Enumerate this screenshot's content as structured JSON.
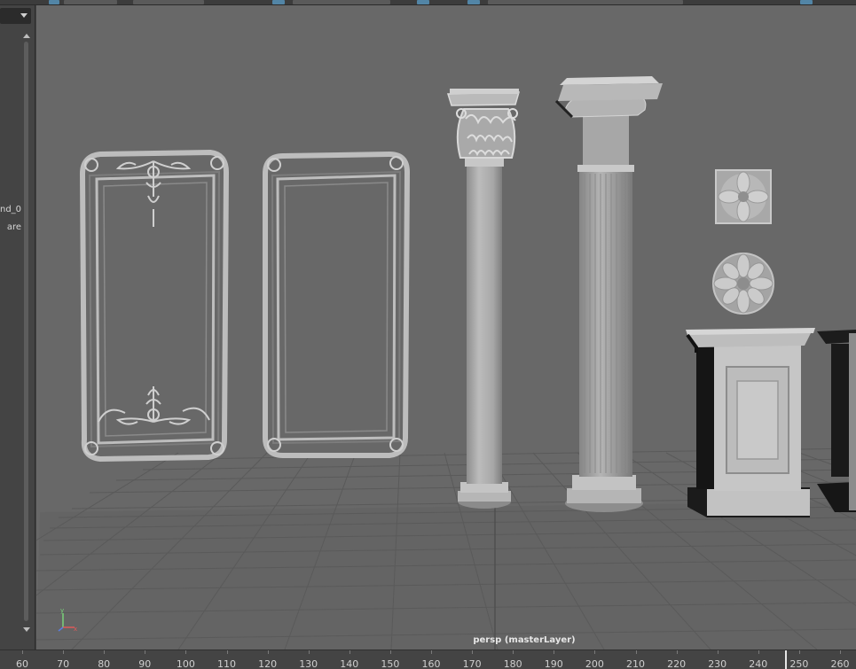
{
  "outliner": {
    "items": [
      {
        "label": "nd_0"
      },
      {
        "label": "are"
      }
    ]
  },
  "viewport": {
    "camera_label": "persp (masterLayer)",
    "axis": {
      "x": "x",
      "y": "y",
      "z": "z"
    }
  },
  "timeslider": {
    "ticks": [
      "60",
      "70",
      "80",
      "90",
      "100",
      "110",
      "120",
      "130",
      "140",
      "150",
      "160",
      "170",
      "180",
      "190",
      "200",
      "210",
      "220",
      "230",
      "240",
      "250",
      "260"
    ],
    "current_frame": "250"
  },
  "colors": {
    "viewport_bg": "#686868",
    "grid": "#5a5a5a",
    "panel_bg": "#444444",
    "accent": "#5285a6",
    "model_light": "#b9b9b9",
    "model_dark": "#1a1a1a"
  }
}
